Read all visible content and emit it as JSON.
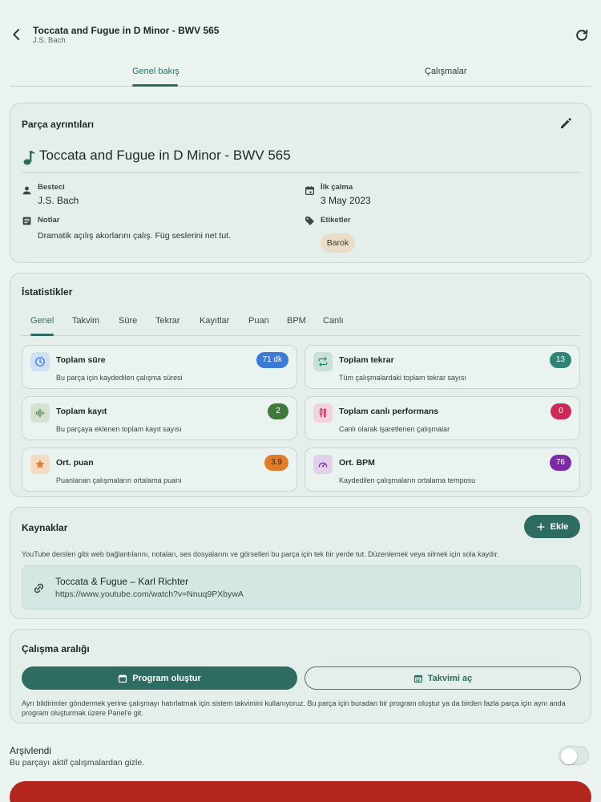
{
  "header": {
    "title": "Toccata and Fugue in D Minor - BWV 565",
    "subtitle": "J.S. Bach"
  },
  "main_tabs": [
    {
      "label": "Genel bakış"
    },
    {
      "label": "Çalışmalar"
    }
  ],
  "details": {
    "heading": "Parça ayrıntıları",
    "piece_title": "Toccata and Fugue in D Minor - BWV 565",
    "composer_label": "Besteci",
    "composer_value": "J.S. Bach",
    "first_play_label": "İlk çalma",
    "first_play_value": "3 May 2023",
    "notes_label": "Notlar",
    "notes_value": "Dramatik açılış akorlarını çalış. Füg seslerini net tut.",
    "tags_label": "Etiketler",
    "tags": [
      "Barok"
    ]
  },
  "stats": {
    "heading": "İstatistikler",
    "tabs": [
      "Genel",
      "Takvim",
      "Süre",
      "Tekrar",
      "Kayıtlar",
      "Puan",
      "BPM",
      "Canlı"
    ],
    "cards": [
      {
        "title": "Toplam süre",
        "desc": "Bu parça için kaydedilen çalışma süresi",
        "badge": "71 dk",
        "icon": "clock-icon",
        "color": "#3b7bd6"
      },
      {
        "title": "Toplam tekrar",
        "desc": "Tüm çalışmalardaki toplam tekrar sayısı",
        "badge": "13",
        "icon": "repeat-icon",
        "color": "#2e8475"
      },
      {
        "title": "Toplam kayıt",
        "desc": "Bu parçaya eklenen toplam kayıt sayısı",
        "badge": "2",
        "icon": "audio-wave-icon",
        "color": "#3e7a3a"
      },
      {
        "title": "Toplam canlı performans",
        "desc": "Canlı olarak işaretlenen çalışmalar",
        "badge": "0",
        "icon": "microphone-icon",
        "color": "#cc2a55"
      },
      {
        "title": "Ort. puan",
        "desc": "Puanlanan çalışmaların ortalama puanı",
        "badge": "3.9",
        "icon": "star-icon",
        "color": "#e07c2a"
      },
      {
        "title": "Ort. BPM",
        "desc": "Kaydedilen çalışmaların ortalama temposu",
        "badge": "76",
        "icon": "speedometer-icon",
        "color": "#7d2aa8"
      }
    ]
  },
  "resources": {
    "heading": "Kaynaklar",
    "add_label": "Ekle",
    "description": "YouTube dersleri gibi web bağlantılarını, notaları, ses dosyalarını ve görselleri bu parça için tek bir yerde tut. Düzenlemek veya silmek için sola kaydır.",
    "items": [
      {
        "title": "Toccata & Fugue – Karl Richter",
        "url": "https://www.youtube.com/watch?v=Nnuq9PXbywA"
      }
    ]
  },
  "practice": {
    "heading": "Çalışma aralığı",
    "create_label": "Program oluştur",
    "calendar_label": "Takvimi aç",
    "description": "Ayrı bildirimler göndermek yerine çalışmayı hatırlatmak için sistem takvimini kullanıyoruz. Bu parça için buradan bir program oluştur ya da birden fazla parça için aynı anda program oluşturmak üzere Panel'e git."
  },
  "archive": {
    "label": "Arşivlendi",
    "desc": "Bu parçayı aktif çalışmalardan gizle.",
    "enabled": false
  },
  "colors": {
    "accent": "#2e6b60",
    "background": "#eaf3f0",
    "danger": "#b3261e"
  }
}
